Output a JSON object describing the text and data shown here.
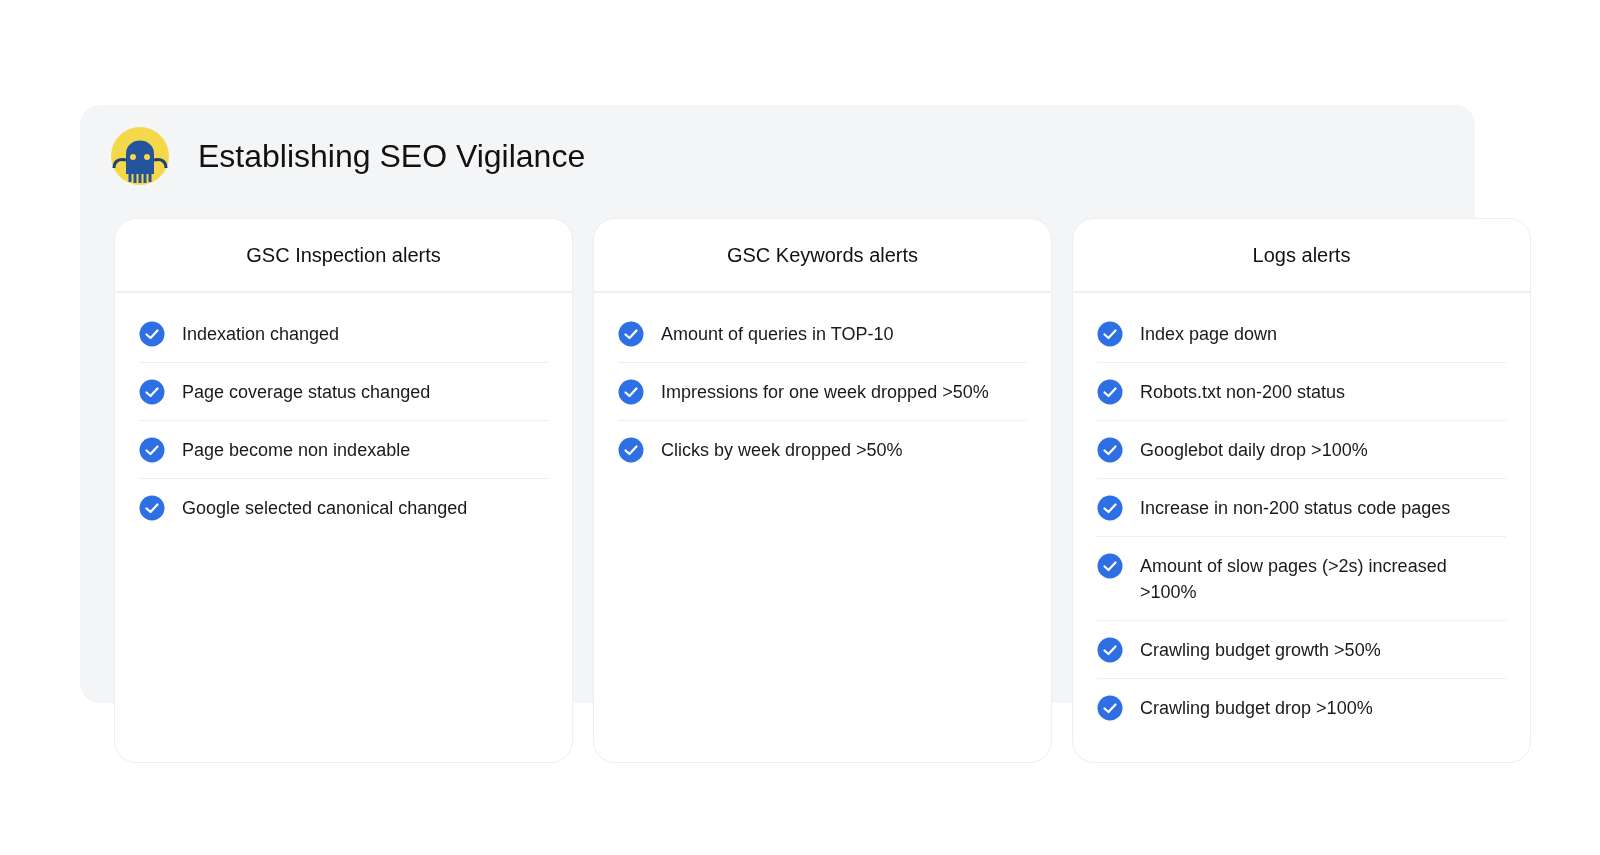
{
  "title": "Establishing SEO Vigilance",
  "cards": [
    {
      "title": "GSC Inspection alerts",
      "items": [
        {
          "text": "Indexation changed",
          "checked": true
        },
        {
          "text": "Page coverage status changed",
          "checked": true
        },
        {
          "text": "Page become non indexable",
          "checked": true
        },
        {
          "text": "Google selected canonical changed",
          "checked": true
        }
      ]
    },
    {
      "title": "GSC Keywords alerts",
      "items": [
        {
          "text": "Amount of queries in TOP-10",
          "checked": true
        },
        {
          "text": "Impressions for one week dropped >50%",
          "checked": true
        },
        {
          "text": "Clicks by week dropped >50%",
          "checked": true
        }
      ]
    },
    {
      "title": "Logs alerts",
      "items": [
        {
          "text": "Index page down",
          "checked": true
        },
        {
          "text": "Robots.txt non-200 status",
          "checked": true
        },
        {
          "text": "Googlebot daily drop >100%",
          "checked": true
        },
        {
          "text": "Increase in non-200 status code pages",
          "checked": true
        },
        {
          "text": "Amount of slow pages (>2s) increased >100%",
          "checked": true
        },
        {
          "text": "Crawling budget growth >50%",
          "checked": true
        },
        {
          "text": "Crawling budget drop >100%",
          "checked": true
        }
      ]
    }
  ]
}
